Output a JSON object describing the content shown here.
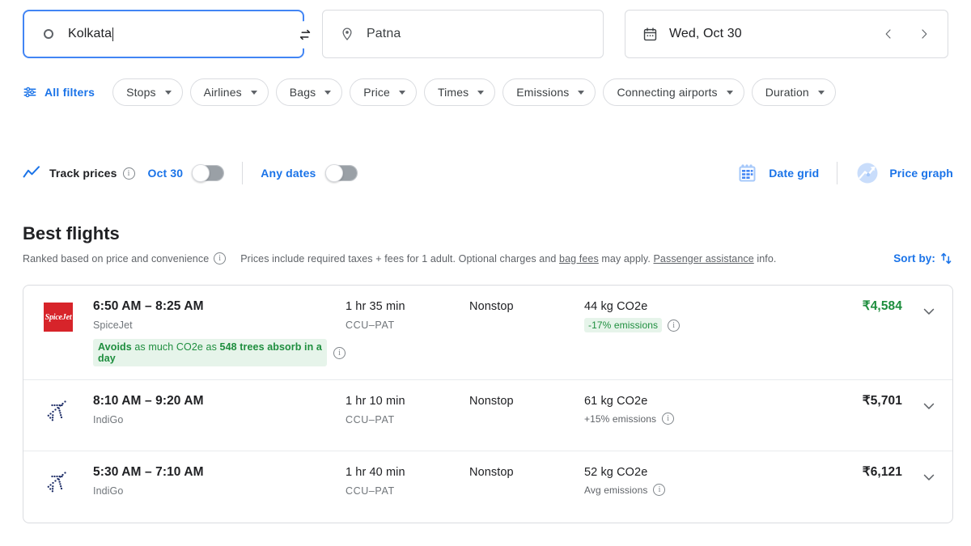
{
  "search": {
    "origin": {
      "value": "Kolkata",
      "icon": "circle-icon"
    },
    "destination": {
      "value": "Patna",
      "icon": "location-pin-icon"
    },
    "swap_icon": "swap-arrows-icon",
    "date": {
      "value": "Wed, Oct 30",
      "icon": "calendar-icon"
    },
    "prev_label": "previous-date",
    "next_label": "next-date"
  },
  "filters": {
    "all_filters": "All filters",
    "all_filters_icon": "tune-filters-icon",
    "chips": [
      {
        "label": "Stops"
      },
      {
        "label": "Airlines"
      },
      {
        "label": "Bags"
      },
      {
        "label": "Price"
      },
      {
        "label": "Times"
      },
      {
        "label": "Emissions"
      },
      {
        "label": "Connecting airports"
      },
      {
        "label": "Duration"
      }
    ]
  },
  "track": {
    "icon": "trend-line-icon",
    "label": "Track prices",
    "info_icon": "info-icon",
    "date_label": "Oct 30",
    "date_toggle_state": "off",
    "any_dates_label": "Any dates",
    "any_dates_toggle_state": "off",
    "date_grid": {
      "label": "Date grid",
      "icon": "date-grid-icon"
    },
    "price_graph": {
      "label": "Price graph",
      "icon": "price-graph-icon"
    }
  },
  "best": {
    "title": "Best flights",
    "ranked": "Ranked based on price and convenience",
    "ranked_info_icon": "info-icon",
    "prices_note_1": "Prices include required taxes + fees for 1 adult. Optional charges and ",
    "prices_link_1": "bag fees",
    "prices_note_2": " may apply. ",
    "prices_link_2": "Passenger assistance",
    "prices_note_3": " info.",
    "sort_by": "Sort by:",
    "sort_icon": "sort-arrows-icon"
  },
  "flights": [
    {
      "logo": "spicejet-logo",
      "logo_text": "SpiceJet",
      "times": "6:50 AM – 8:25 AM",
      "airline": "SpiceJet",
      "duration": "1 hr 35 min",
      "route": "CCU–PAT",
      "stops": "Nonstop",
      "emissions": "44 kg CO2e",
      "emissions_note": "-17% emissions",
      "emissions_note_style": "badge",
      "emissions_info_icon": "info-icon",
      "price": "₹4,584",
      "price_style": "cheap",
      "banner_bold_1": "Avoids",
      "banner_mid": " as much CO2e as ",
      "banner_bold_2": "548 trees absorb in a day",
      "banner_info_icon": "info-icon",
      "expand_icon": "chevron-down-icon"
    },
    {
      "logo": "indigo-logo",
      "logo_text": "",
      "times": "8:10 AM – 9:20 AM",
      "airline": "IndiGo",
      "duration": "1 hr 10 min",
      "route": "CCU–PAT",
      "stops": "Nonstop",
      "emissions": "61 kg CO2e",
      "emissions_note": "+15% emissions",
      "emissions_note_style": "plain",
      "emissions_info_icon": "info-icon",
      "price": "₹5,701",
      "price_style": "normal",
      "expand_icon": "chevron-down-icon"
    },
    {
      "logo": "indigo-logo",
      "logo_text": "",
      "times": "5:30 AM – 7:10 AM",
      "airline": "IndiGo",
      "duration": "1 hr 40 min",
      "route": "CCU–PAT",
      "stops": "Nonstop",
      "emissions": "52 kg CO2e",
      "emissions_note": "Avg emissions",
      "emissions_note_style": "plain",
      "emissions_info_icon": "info-icon",
      "price": "₹6,121",
      "price_style": "normal",
      "expand_icon": "chevron-down-icon"
    }
  ],
  "colors": {
    "accent_blue": "#1a73e8",
    "focus_blue": "#4285f4",
    "green": "#1e8e3e",
    "green_bg": "#e6f4ea",
    "spicejet_red": "#d7242a",
    "indigo_navy": "#1b2b65",
    "border": "#dadce0",
    "text": "#202124",
    "muted": "#70757a"
  }
}
